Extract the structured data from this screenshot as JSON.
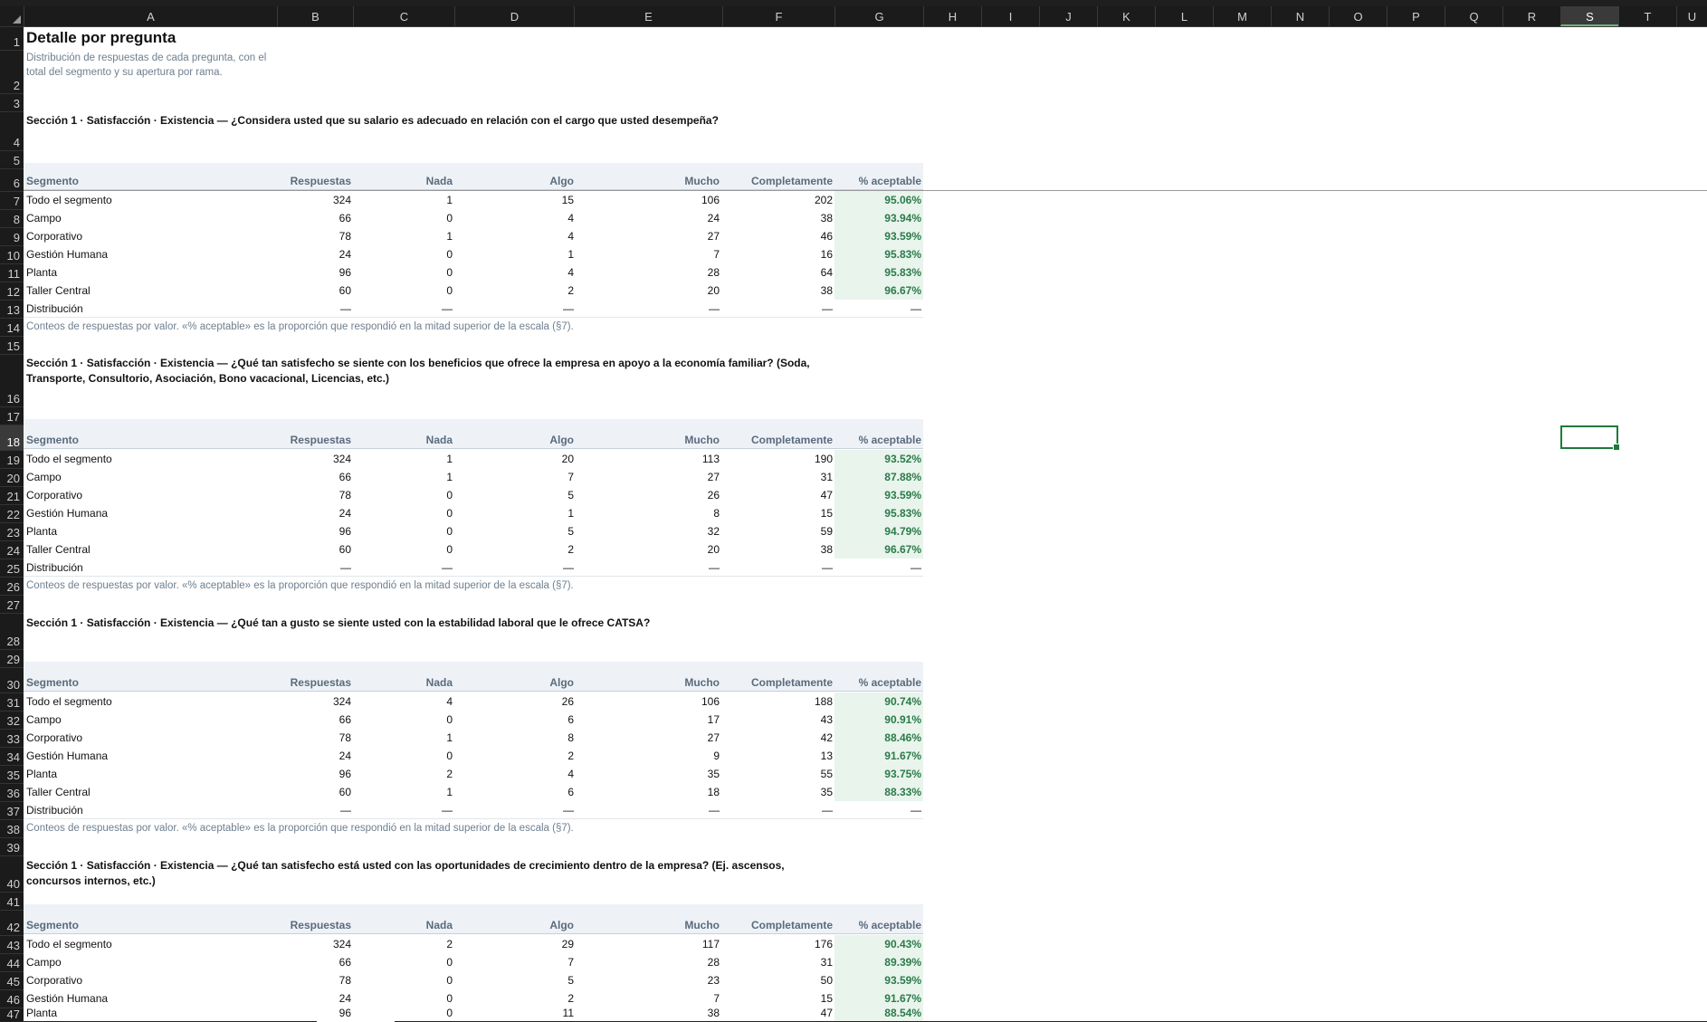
{
  "columns": [
    "A",
    "B",
    "C",
    "D",
    "E",
    "F",
    "G",
    "H",
    "I",
    "J",
    "K",
    "L",
    "M",
    "N",
    "O",
    "P",
    "Q",
    "R",
    "S",
    "T",
    "U"
  ],
  "selected_column": "S",
  "selected_row": "18",
  "rows": [
    "1",
    "2",
    "3",
    "4",
    "5",
    "6",
    "7",
    "8",
    "9",
    "10",
    "11",
    "12",
    "13",
    "14",
    "15",
    "16",
    "17",
    "18",
    "19",
    "20",
    "21",
    "22",
    "23",
    "24",
    "25",
    "26",
    "27",
    "28",
    "29",
    "30",
    "31",
    "32",
    "33",
    "34",
    "35",
    "36",
    "37",
    "38",
    "39",
    "40",
    "41",
    "42",
    "43",
    "44",
    "45",
    "46",
    "47"
  ],
  "page": {
    "title": "Detalle por pregunta",
    "subtitle": "Distribución de respuestas de cada pregunta, con el total del segmento y su apertura por rama."
  },
  "header_labels": [
    "Segmento",
    "Respuestas",
    "Nada",
    "Algo",
    "Mucho",
    "Completamente",
    "% aceptable"
  ],
  "dash": "—",
  "note": "Conteos de respuestas por valor. «% aceptable» es la proporción que respondió en la mitad superior de la escala (§7).",
  "dist_label": "Distribución",
  "sections": [
    {
      "question": "Sección 1 · Satisfacción · Existencia — ¿Considera usted que su salario es adecuado en relación con el cargo que usted desempeña?",
      "rows": [
        [
          "Todo el segmento",
          "324",
          "1",
          "15",
          "106",
          "202",
          "95.06%"
        ],
        [
          "Campo",
          "66",
          "0",
          "4",
          "24",
          "38",
          "93.94%"
        ],
        [
          "Corporativo",
          "78",
          "1",
          "4",
          "27",
          "46",
          "93.59%"
        ],
        [
          "Gestión Humana",
          "24",
          "0",
          "1",
          "7",
          "16",
          "95.83%"
        ],
        [
          "Planta",
          "96",
          "0",
          "4",
          "28",
          "64",
          "95.83%"
        ],
        [
          "Taller Central",
          "60",
          "0",
          "2",
          "20",
          "38",
          "96.67%"
        ]
      ]
    },
    {
      "question": "Sección 1 · Satisfacción · Existencia — ¿Qué tan satisfecho se siente con los beneficios que ofrece la empresa en apoyo a la economía familiar? (Soda, Transporte, Consultorio, Asociación, Bono vacacional, Licencias, etc.)",
      "rows": [
        [
          "Todo el segmento",
          "324",
          "1",
          "20",
          "113",
          "190",
          "93.52%"
        ],
        [
          "Campo",
          "66",
          "1",
          "7",
          "27",
          "31",
          "87.88%"
        ],
        [
          "Corporativo",
          "78",
          "0",
          "5",
          "26",
          "47",
          "93.59%"
        ],
        [
          "Gestión Humana",
          "24",
          "0",
          "1",
          "8",
          "15",
          "95.83%"
        ],
        [
          "Planta",
          "96",
          "0",
          "5",
          "32",
          "59",
          "94.79%"
        ],
        [
          "Taller Central",
          "60",
          "0",
          "2",
          "20",
          "38",
          "96.67%"
        ]
      ]
    },
    {
      "question": "Sección 1 · Satisfacción · Existencia — ¿Qué tan a gusto se siente usted con la estabilidad laboral que le ofrece CATSA?",
      "rows": [
        [
          "Todo el segmento",
          "324",
          "4",
          "26",
          "106",
          "188",
          "90.74%"
        ],
        [
          "Campo",
          "66",
          "0",
          "6",
          "17",
          "43",
          "90.91%"
        ],
        [
          "Corporativo",
          "78",
          "1",
          "8",
          "27",
          "42",
          "88.46%"
        ],
        [
          "Gestión Humana",
          "24",
          "0",
          "2",
          "9",
          "13",
          "91.67%"
        ],
        [
          "Planta",
          "96",
          "2",
          "4",
          "35",
          "55",
          "93.75%"
        ],
        [
          "Taller Central",
          "60",
          "1",
          "6",
          "18",
          "35",
          "88.33%"
        ]
      ]
    },
    {
      "question": "Sección 1 · Satisfacción · Existencia — ¿Qué tan satisfecho está usted con las oportunidades de crecimiento dentro de la empresa? (Ej. ascensos, concursos internos, etc.)",
      "rows": [
        [
          "Todo el segmento",
          "324",
          "2",
          "29",
          "117",
          "176",
          "90.43%"
        ],
        [
          "Campo",
          "66",
          "0",
          "7",
          "28",
          "31",
          "89.39%"
        ],
        [
          "Corporativo",
          "78",
          "0",
          "5",
          "23",
          "50",
          "93.59%"
        ],
        [
          "Gestión Humana",
          "24",
          "0",
          "2",
          "7",
          "15",
          "91.67%"
        ],
        [
          "Planta",
          "96",
          "0",
          "11",
          "38",
          "47",
          "88.54%"
        ]
      ]
    }
  ]
}
